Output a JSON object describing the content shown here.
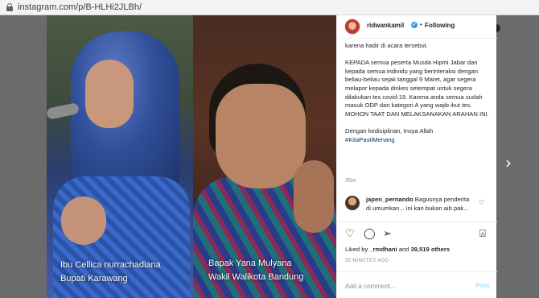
{
  "browser": {
    "url": "instagram.com/p/B-HLHi2JLBh/"
  },
  "photo": {
    "caption_left_line1": "Ibu  Cellica nurrachadiana",
    "caption_left_line2": "Bupati Karawang",
    "caption_right_line1": "Bapak Yana Mulyana",
    "caption_right_line2": "Wakil Walikota Bandung"
  },
  "post": {
    "username": "ridwankamil",
    "verified_icon": "✔",
    "separator": "•",
    "follow_status": "Following",
    "caption_lines": [
      "karena hadir di acara tersebut.",
      "KEPADA semua peserta Musda Hipmi Jabar dan kepada semua individu yang berinteraksi dengan beliau-beliau sejak tanggal 9 Maret, agar segera melapor kepada dinkes setempat untuk segera dilakukan tes covid-19. Karena anda semua sudah masuk ODP dan kategori A yang wajib ikut tes. MOHON TAAT DAN MELAKSANAKAN ARAHAN INI.",
      "Dengan kedisiplinan, Insya Allah"
    ],
    "hashtag": "#KitaPastiMenang",
    "caption_time": "35m",
    "comment": {
      "username": "japen_pernando",
      "text": "Bagusnya penderita di umumkan... ini kan bukan aib pak..."
    },
    "icons": {
      "like": "heart-icon",
      "comment": "comment-icon",
      "share": "share-icon",
      "save": "bookmark-icon",
      "next": "chevron-right-icon"
    },
    "likes": {
      "prefix": "Liked by",
      "user": "_rmdhani",
      "middle": "and",
      "count": "39,519 others"
    },
    "time_ago": "35 MINUTES AGO",
    "add_comment_placeholder": "Add a comment...",
    "post_label": "Post"
  },
  "colors": {
    "link_blue": "#003569",
    "verified_blue": "#3897f0",
    "post_button_disabled": "#b2dffc"
  }
}
